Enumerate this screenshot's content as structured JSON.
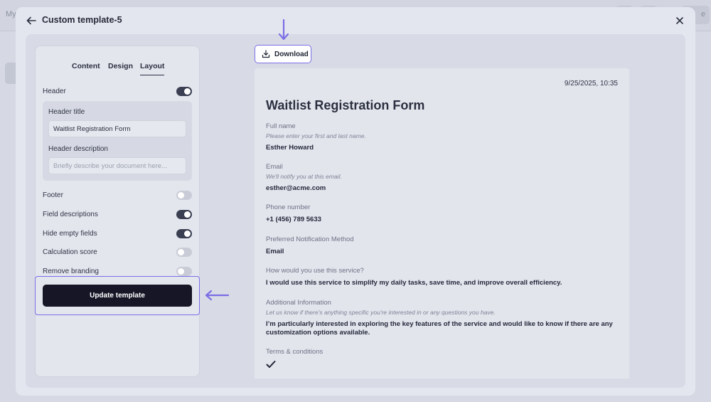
{
  "background": {
    "topbar_left_text": "My",
    "topbar_right_text": "e"
  },
  "modal": {
    "title": "Custom template-5",
    "back_icon": "arrow-left-icon",
    "close_icon": "close-icon"
  },
  "panel": {
    "tabs": [
      {
        "label": "Content",
        "active": false
      },
      {
        "label": "Design",
        "active": false
      },
      {
        "label": "Layout",
        "active": true
      }
    ],
    "header_toggle": {
      "label": "Header",
      "on": true
    },
    "header_title_label": "Header title",
    "header_title_value": "Waitlist Registration Form",
    "header_description_label": "Header description",
    "header_description_placeholder": "Briefly describe your document here...",
    "toggles": [
      {
        "label": "Footer",
        "on": false
      },
      {
        "label": "Field descriptions",
        "on": true
      },
      {
        "label": "Hide empty fields",
        "on": true
      },
      {
        "label": "Calculation score",
        "on": false
      },
      {
        "label": "Remove branding",
        "on": false
      }
    ],
    "update_button": "Update template"
  },
  "toolbar": {
    "download_label": "Download",
    "download_icon": "download-icon"
  },
  "document": {
    "date": "9/25/2025, 10:35",
    "title": "Waitlist Registration Form",
    "fields": [
      {
        "label": "Full name",
        "description": "Please enter your first and last name.",
        "value": "Esther Howard"
      },
      {
        "label": "Email",
        "description": "We'll notify you at this email.",
        "value": "esther@acme.com"
      },
      {
        "label": "Phone number",
        "description": "",
        "value": "+1 (456) 789 5633"
      },
      {
        "label": "Preferred Notification Method",
        "description": "",
        "value": "Email"
      },
      {
        "label": "How would you use this service?",
        "description": "",
        "value": "I would use this service to simplify my daily tasks, save time, and improve overall efficiency."
      },
      {
        "label": "Additional Information",
        "description": "Let us know if there's anything specific you're interested in or any questions you have.",
        "value": "I’m particularly interested in exploring the key features of the service and would like to know if there are any customization options available."
      },
      {
        "label": "Terms & conditions",
        "description": "",
        "value": ""
      }
    ],
    "terms_icon": "checkmark-icon"
  },
  "colors": {
    "accent": "#7b6ee6",
    "primary_button": "#161626",
    "toggle_on": "#3a3f52",
    "toggle_off": "#c9ccd6"
  }
}
